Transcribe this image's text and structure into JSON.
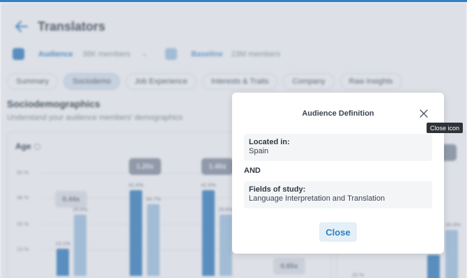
{
  "page": {
    "title": "Translators",
    "audience": {
      "label": "Audience",
      "members": "38K members"
    },
    "baseline": {
      "label": "Baseline",
      "members": "23M members"
    }
  },
  "tabs": [
    "Summary",
    "Sociodemo",
    "Job Experience",
    "Interests & Traits",
    "Company",
    "Raw Insights"
  ],
  "section": {
    "title": "Sociodemographics",
    "subtitle": "Understand your audience members' demographics"
  },
  "chart_data": {
    "type": "bar",
    "title": "Age",
    "yticks": [
      "50 %",
      "38 %",
      "25 %",
      "13 %"
    ],
    "series": [
      {
        "values": [
          13.1,
          41.6,
          41.6
        ]
      },
      {
        "values": [
          29.6,
          34.7,
          29.6
        ]
      }
    ],
    "value_labels": [
      "13.1%",
      "29.6%",
      "41.6%",
      "34.7%",
      "41.6%",
      "29.6%"
    ],
    "index_pills": [
      "0.44x",
      "1.20x",
      "1.40x",
      "0.65x"
    ],
    "right_card": {
      "ytick": "20 %",
      "value_label": "45.9%"
    }
  },
  "modal": {
    "title": "Audience Definition",
    "criteria": [
      {
        "label": "Located in:",
        "value": "Spain"
      },
      {
        "label": "Fields of study:",
        "value": "Language Interpretation and Translation"
      }
    ],
    "operator": "AND",
    "close_label": "Close"
  },
  "tooltip": "Close icon",
  "colors": {
    "accent": "#2e7fc2",
    "audience": "#3d86c6",
    "baseline": "#a9cbe8"
  }
}
